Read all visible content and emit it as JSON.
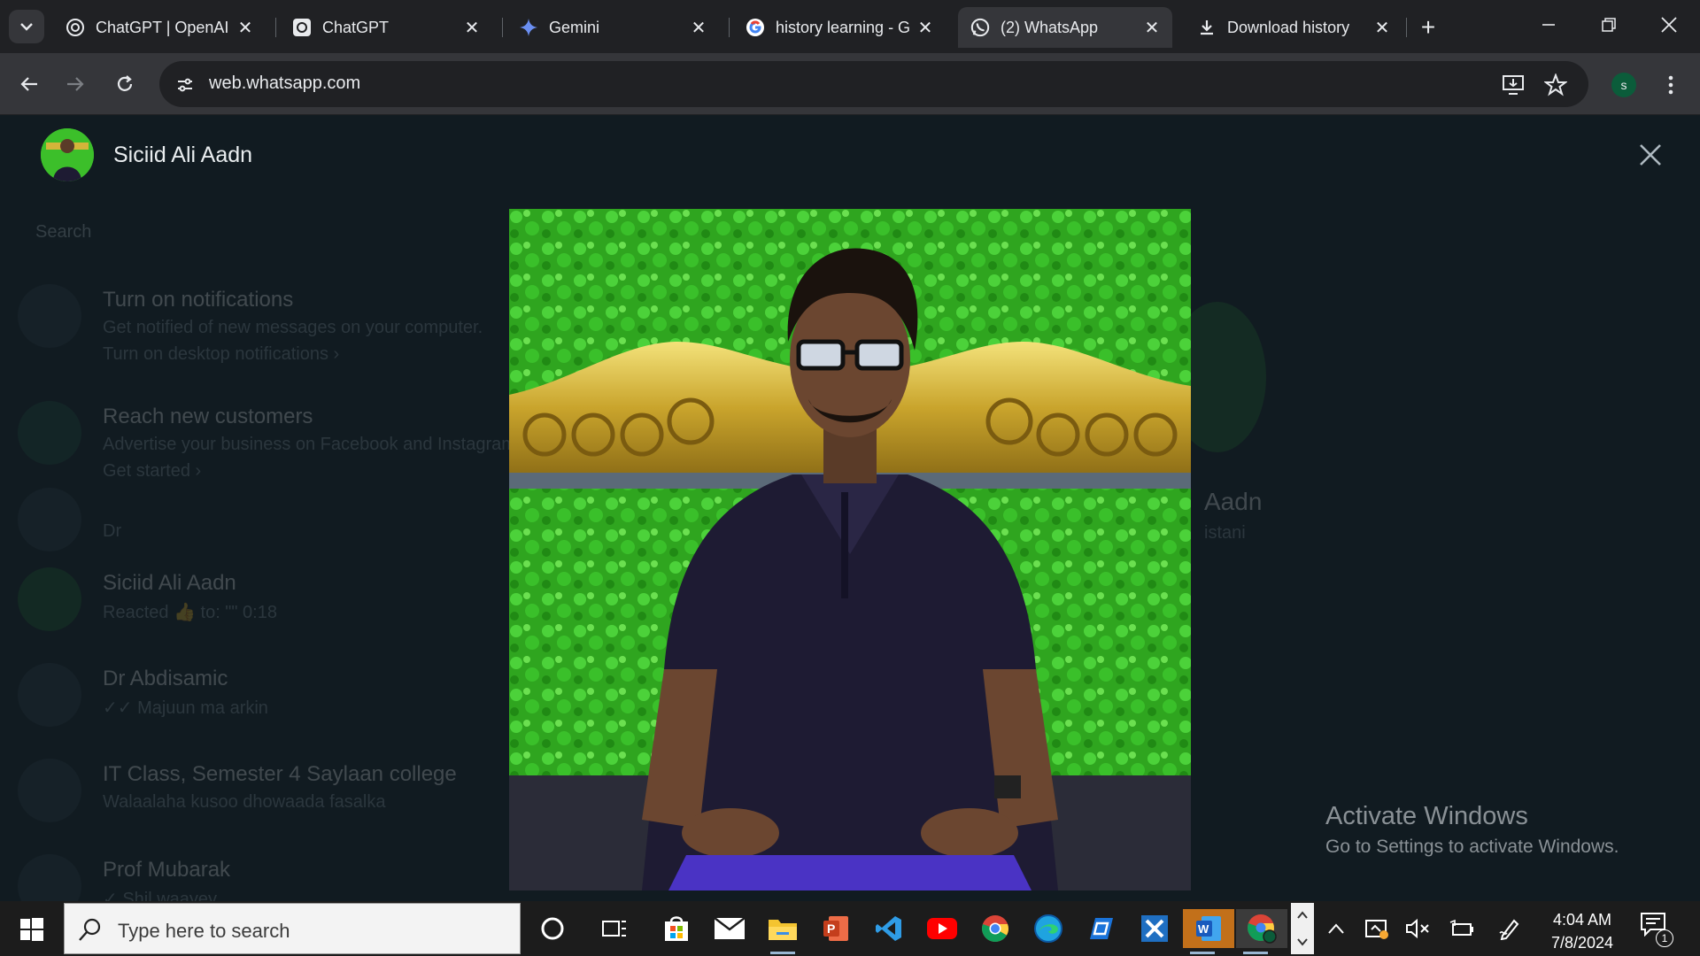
{
  "browser": {
    "tabs": [
      {
        "title": "ChatGPT | OpenAI",
        "icon": "openai-icon",
        "active": false
      },
      {
        "title": "ChatGPT",
        "icon": "openai-icon",
        "active": false
      },
      {
        "title": "Gemini",
        "icon": "gemini-icon",
        "active": false
      },
      {
        "title": "history learning - G",
        "icon": "google-icon",
        "active": false
      },
      {
        "title": "(2) WhatsApp",
        "icon": "whatsapp-icon",
        "active": true
      },
      {
        "title": "Download history",
        "icon": "download-icon",
        "active": false
      }
    ],
    "url": "web.whatsapp.com",
    "profile_initial": "s"
  },
  "viewer": {
    "contact_name": "Siciid Ali Aadn"
  },
  "background_chat_list": {
    "search_placeholder": "Search",
    "items": [
      {
        "title": "Turn on notifications",
        "line1": "Get notified of new messages on your computer.",
        "line2": "Turn on desktop notifications ›"
      },
      {
        "title": "Reach new customers",
        "line1": "Advertise your business on Facebook and Instagram.",
        "line2": "Get started ›"
      },
      {
        "title": "",
        "line1": "Dr",
        "line2": ""
      },
      {
        "title": "Siciid Ali Aadn",
        "line1": "Reacted 👍 to: \"\" 0:18",
        "line2": ""
      },
      {
        "title": "Dr Abdisamic",
        "line1": "✓✓ Majuun ma arkin",
        "line2": ""
      },
      {
        "title": "IT Class, Semester 4 Saylaan college",
        "line1": "Walaalaha kusoo dhowaada fasalka",
        "line2": ""
      },
      {
        "title": "Prof Mubarak",
        "line1": "✓ Shil waayey",
        "line2": ""
      }
    ],
    "right_name": "Aadn",
    "right_sub": "istani"
  },
  "watermark": {
    "line1": "Activate Windows",
    "line2": "Go to Settings to activate Windows."
  },
  "taskbar": {
    "search_placeholder": "Type here to search",
    "pinned": [
      "cortana-icon",
      "task-view-icon",
      "microsoft-store-icon",
      "mail-icon",
      "file-explorer-icon",
      "powerpoint-icon",
      "vscode-icon",
      "youtube-icon",
      "chrome-icon",
      "edge-icon",
      "packet-tracer-icon",
      "dev-tool-icon",
      "word-icon",
      "chrome-profile-icon"
    ],
    "time": "4:04 AM",
    "date": "7/8/2024",
    "notification_count": "1"
  },
  "colors": {
    "whatsapp_bg": "#111b21",
    "chrome_dark": "#202124",
    "chrome_toolbar": "#35363a",
    "photo_green": "#3cbf2a",
    "shirt_navy": "#1e1b33",
    "ornament_gold": "#d4b43a"
  }
}
